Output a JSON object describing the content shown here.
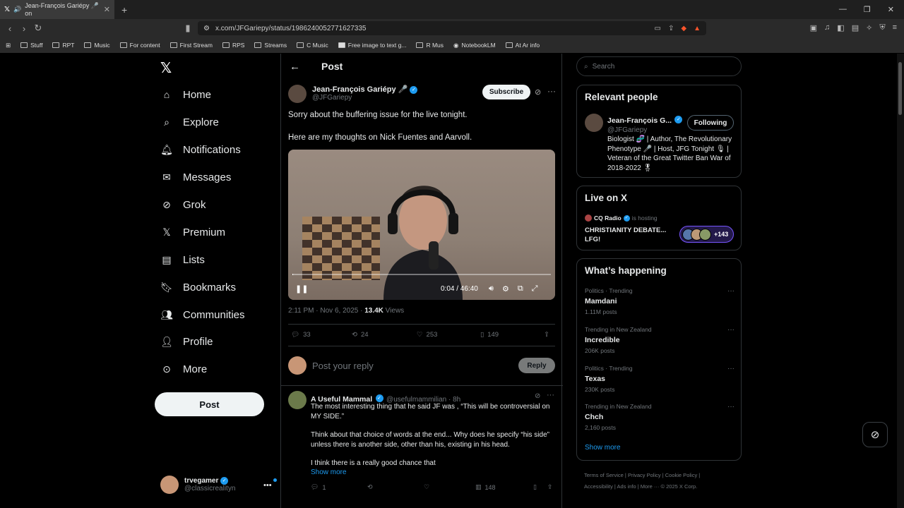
{
  "browser": {
    "tab_title": "Jean-François Gariépy 🎤 on",
    "url": "x.com/JFGariepy/status/1986240052771627335",
    "bookmarks": [
      "Stuff",
      "RPT",
      "Music",
      "For content",
      "First Stream",
      "RPS",
      "Streams",
      "C Music",
      "Free image to text g...",
      "R Mus",
      "NotebookLM",
      "At Ar info"
    ]
  },
  "nav": {
    "items": [
      {
        "label": "Home",
        "icon": "home-icon"
      },
      {
        "label": "Explore",
        "icon": "search-icon"
      },
      {
        "label": "Notifications",
        "icon": "bell-icon"
      },
      {
        "label": "Messages",
        "icon": "envelope-icon"
      },
      {
        "label": "Grok",
        "icon": "grok-icon"
      },
      {
        "label": "Premium",
        "icon": "x-icon"
      },
      {
        "label": "Lists",
        "icon": "list-icon"
      },
      {
        "label": "Bookmarks",
        "icon": "bookmark-icon"
      },
      {
        "label": "Communities",
        "icon": "people-icon"
      },
      {
        "label": "Profile",
        "icon": "person-icon"
      },
      {
        "label": "More",
        "icon": "more-circle-icon"
      }
    ],
    "post_label": "Post",
    "account": {
      "name": "trvegamer",
      "handle": "@classicrealityn"
    }
  },
  "post": {
    "header_title": "Post",
    "author_name": "Jean-François Gariépy 🎤",
    "author_handle": "@JFGariepy",
    "subscribe_label": "Subscribe",
    "line1": "Sorry about the buffering issue for the live tonight.",
    "line2": "Here are my thoughts on Nick Fuentes and Aarvoll.",
    "video_time": "0:04 / 46:40",
    "video_progress": 0.0014,
    "timestamp": "2:11 PM · Nov 6, 2025 · ",
    "views_count": "13.4K",
    "views_label": " Views",
    "replies": "33",
    "reposts": "24",
    "likes": "253",
    "bookmarks": "149",
    "reply_placeholder": "Post your reply",
    "reply_button": "Reply"
  },
  "reply": {
    "name": "A Useful Mammal",
    "handle": "@usefulmammilian · 8h",
    "p1": "The most interesting thing that he said JF was , “This will be controversial on MY SIDE.”",
    "p2": "Think about that choice of words at the end... Why does he specify “his side” unless there is another side, other than his, existing in his head.",
    "p3": "I think there is a really good chance that",
    "show_more": "Show more",
    "replies": "1",
    "views": "148"
  },
  "sidebar": {
    "search_placeholder": "Search",
    "relevant_title": "Relevant people",
    "rp_name": "Jean-François G...",
    "rp_handle": "@JFGariepy",
    "following_label": "Following",
    "rp_bio": "Biologist 🧬 | Author, The Revolutionary Phenotype 🎤 | Host, JFG Tonight 🎙 | Veteran of the Great Twitter Ban War of 2018-2022 🎖",
    "live_title": "Live on X",
    "live_host": "CQ Radio",
    "live_hosting": "is hosting",
    "live_space": "CHRISTIANITY DEBATE... LFG!",
    "live_count": "+143",
    "happening_title": "What’s happening",
    "trends": [
      {
        "context": "Politics · Trending",
        "title": "Mamdani",
        "count": "1.11M posts"
      },
      {
        "context": "Trending in New Zealand",
        "title": "Incredible",
        "count": "206K posts"
      },
      {
        "context": "Politics · Trending",
        "title": "Texas",
        "count": "230K posts"
      },
      {
        "context": "Trending in New Zealand",
        "title": "Chch",
        "count": "2,160 posts"
      }
    ],
    "show_more": "Show more",
    "footer_line1": "Terms of Service  |  Privacy Policy  |  Cookie Policy  |",
    "footer_line2": "Accessibility  |  Ads info  |  More ···  © 2025 X Corp."
  }
}
